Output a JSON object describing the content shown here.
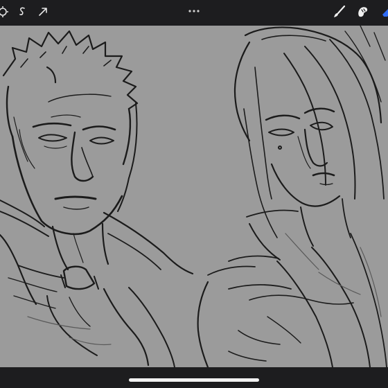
{
  "app": {
    "toolbar": {
      "left_tools": [
        "actions-icon",
        "selection-icon",
        "transform-icon"
      ],
      "more_menu_icon": "more-dots-icon",
      "right_tools": [
        "brush-icon",
        "smudge-icon"
      ]
    },
    "canvas": {
      "background_color": "#9b9b9b",
      "stroke_color": "#1b1b1b"
    },
    "chrome_color": "#1d1d1f",
    "home_indicator_color": "#f2f2f2"
  }
}
